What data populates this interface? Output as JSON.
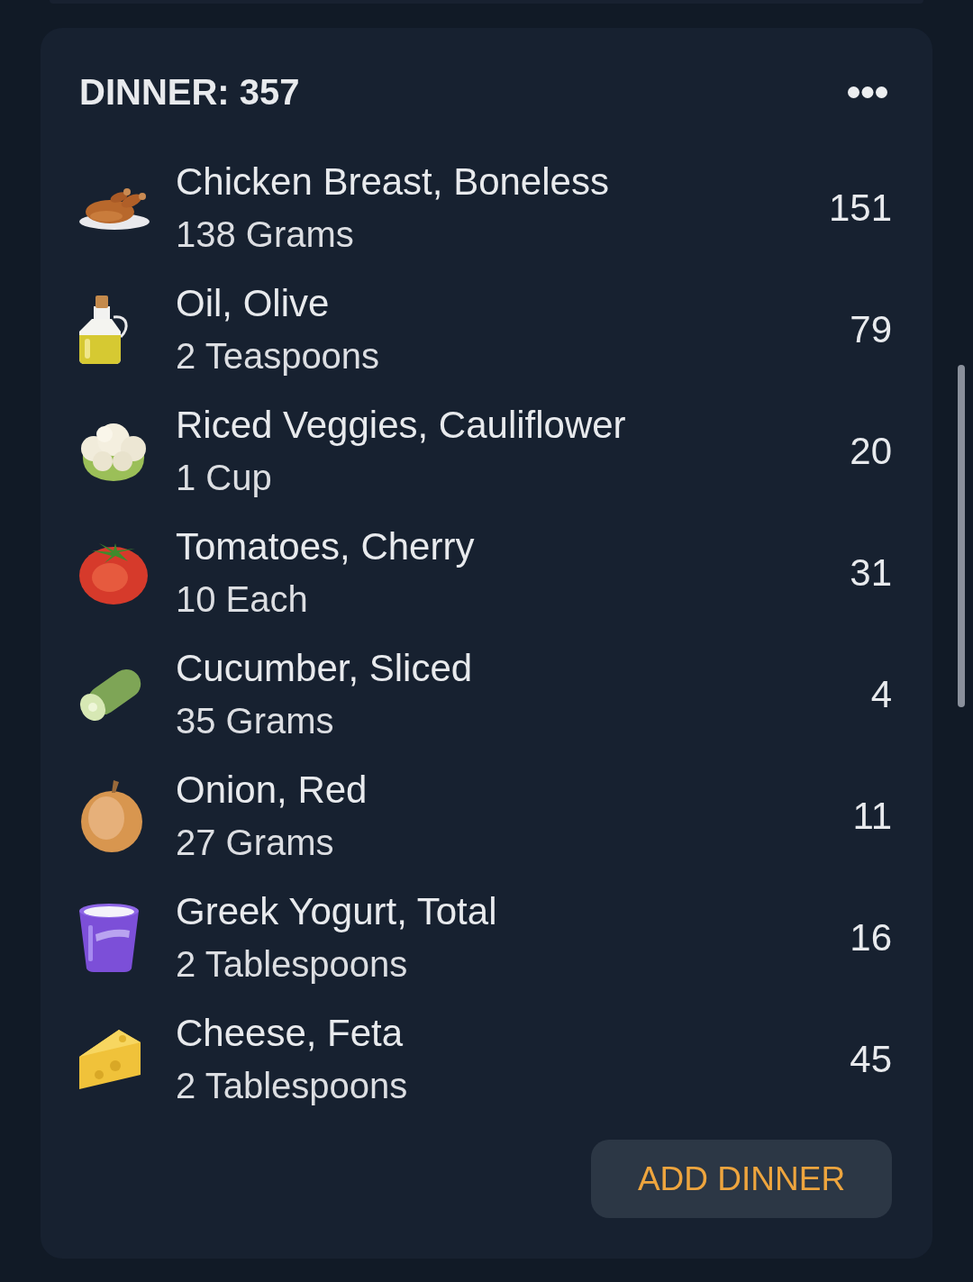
{
  "meal_card": {
    "title": "DINNER: 357",
    "items": [
      {
        "name": "Chicken Breast, Boneless",
        "amount": "138 Grams",
        "calories": "151"
      },
      {
        "name": "Oil, Olive",
        "amount": "2 Teaspoons",
        "calories": "79"
      },
      {
        "name": "Riced Veggies, Cauliflower",
        "amount": "1 Cup",
        "calories": "20"
      },
      {
        "name": "Tomatoes, Cherry",
        "amount": "10 Each",
        "calories": "31"
      },
      {
        "name": "Cucumber, Sliced",
        "amount": "35 Grams",
        "calories": "4"
      },
      {
        "name": "Onion, Red",
        "amount": "27 Grams",
        "calories": "11"
      },
      {
        "name": "Greek Yogurt, Total",
        "amount": "2 Tablespoons",
        "calories": "16"
      },
      {
        "name": "Cheese, Feta",
        "amount": "2 Tablespoons",
        "calories": "45"
      }
    ],
    "add_button": "ADD DINNER"
  }
}
